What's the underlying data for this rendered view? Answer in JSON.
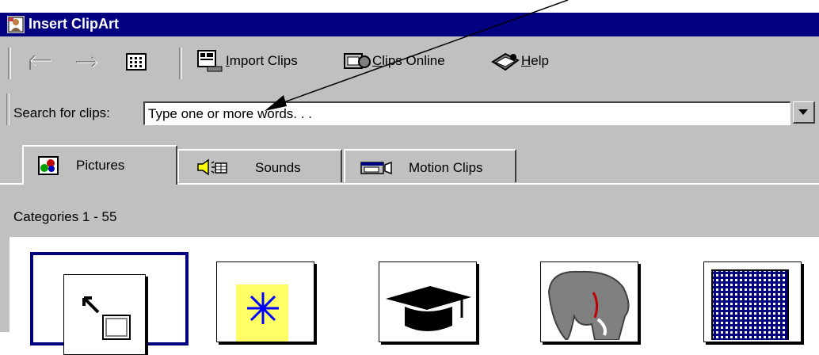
{
  "window": {
    "title": "Insert ClipArt"
  },
  "toolbar": {
    "import_label_prefix": "",
    "import_label_u": "I",
    "import_label_rest": "mport Clips",
    "online_label_u": "C",
    "online_label_rest": "lips Online",
    "help_label_u": "H",
    "help_label_rest": "elp"
  },
  "search": {
    "label": "Search for clips:",
    "placeholder": "Type one or more words. . ."
  },
  "tabs": [
    {
      "label": "Pictures",
      "active": true,
      "icon": "pictures-icon"
    },
    {
      "label": "Sounds",
      "active": false,
      "icon": "sounds-icon"
    },
    {
      "label": "Motion Clips",
      "active": false,
      "icon": "motion-clips-icon"
    }
  ],
  "categories": {
    "label": "Categories 1 - 55"
  },
  "thumbnails": [
    {
      "icon": "add-clip-icon"
    },
    {
      "icon": "star-burst-icon"
    },
    {
      "icon": "graduation-cap-icon"
    },
    {
      "icon": "elephant-icon"
    },
    {
      "icon": "grid-pattern-icon"
    }
  ],
  "colors": {
    "title_bar": "#000080",
    "chrome": "#c0c0c0",
    "selection_border": "#000080"
  }
}
